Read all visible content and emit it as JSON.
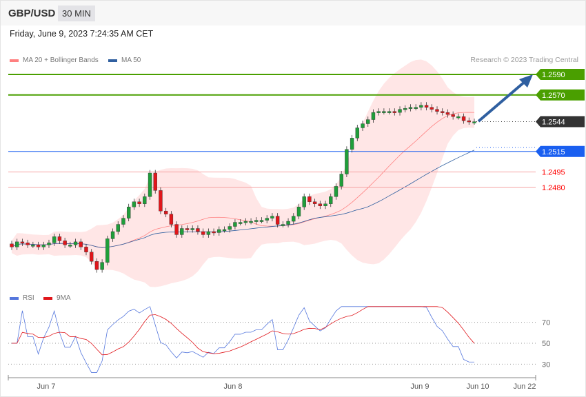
{
  "header": {
    "symbol": "GBP/USD",
    "timeframe": "30 MIN",
    "datetime": "Friday, June 9, 2023 7:24:35 AM CET"
  },
  "legend": {
    "ma20": "MA 20 + Bollinger Bands",
    "ma50": "MA 50",
    "rsi": "RSI",
    "rsi_ma": "9MA"
  },
  "credit": "Research © 2023 Trading Central",
  "colors": {
    "up": "#1f9e3a",
    "down": "#e0161b",
    "ma20": "#ff8080",
    "ma50": "#3060a0",
    "target": "#4a9f00",
    "current": "#333333",
    "support_blue": "#1a5ff0",
    "support_red": "#ff0000",
    "rsi": "#5577dd"
  },
  "chart_data": {
    "type": "line",
    "title": "GBP/USD 30 MIN",
    "levels": [
      {
        "label": "1.2590",
        "value": 1.259,
        "kind": "target"
      },
      {
        "label": "1.2570",
        "value": 1.257,
        "kind": "target"
      },
      {
        "label": "1.2544",
        "value": 1.2544,
        "kind": "current"
      },
      {
        "label": "1.2515",
        "value": 1.2515,
        "kind": "support_blue"
      },
      {
        "label": "1.2495",
        "value": 1.2495,
        "kind": "support_red"
      },
      {
        "label": "1.2480",
        "value": 1.248,
        "kind": "support_red"
      }
    ],
    "closes": [
      1.2422,
      1.2427,
      1.2426,
      1.2424,
      1.2424,
      1.2422,
      1.2424,
      1.2426,
      1.2432,
      1.2428,
      1.2424,
      1.2424,
      1.2427,
      1.2422,
      1.2417,
      1.2408,
      1.24,
      1.2407,
      1.243,
      1.2437,
      1.2444,
      1.245,
      1.2461,
      1.2466,
      1.2464,
      1.2471,
      1.2494,
      1.2477,
      1.2457,
      1.2454,
      1.2444,
      1.2434,
      1.244,
      1.2439,
      1.244,
      1.2437,
      1.2434,
      1.2437,
      1.2436,
      1.2439,
      1.2439,
      1.2442,
      1.2446,
      1.2446,
      1.2447,
      1.2447,
      1.2448,
      1.2448,
      1.245,
      1.2452,
      1.2444,
      1.2444,
      1.2447,
      1.2452,
      1.2461,
      1.2471,
      1.2466,
      1.2464,
      1.2462,
      1.2464,
      1.2471,
      1.2481,
      1.2493,
      1.2517,
      1.2528,
      1.2538,
      1.2542,
      1.2546,
      1.2553,
      1.2554,
      1.2554,
      1.2554,
      1.2553,
      1.2556,
      1.2557,
      1.2558,
      1.2558,
      1.256,
      1.2558,
      1.2556,
      1.2554,
      1.2553,
      1.2551,
      1.2549,
      1.2549,
      1.2545,
      1.2544,
      1.2544
    ],
    "rsi_ticks": [
      "70",
      "50",
      "30"
    ],
    "x_labels": [
      "Jun 7",
      "Jun 8",
      "Jun 9",
      "Jun 10",
      "Jun 22"
    ]
  }
}
